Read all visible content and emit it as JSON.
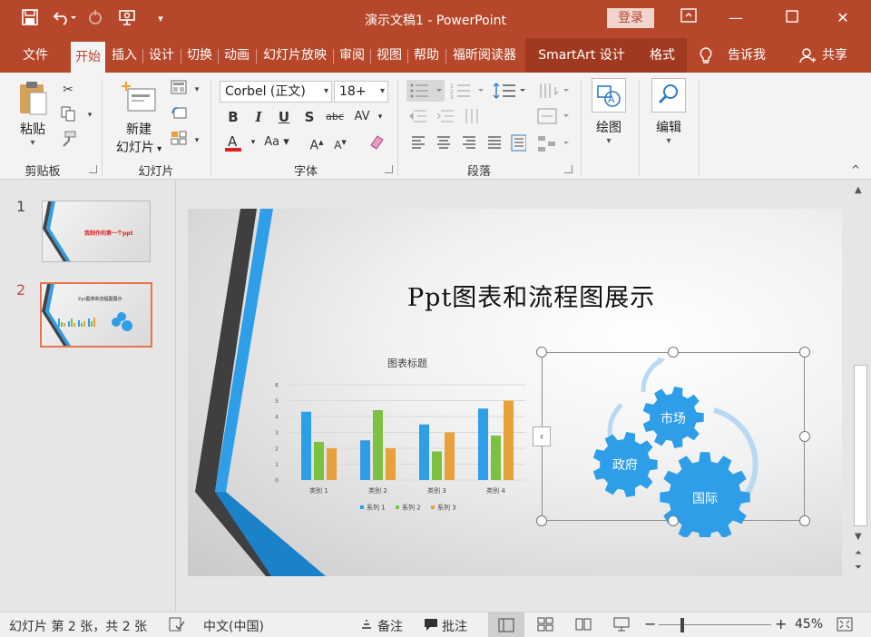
{
  "titlebar": {
    "doc_title": "演示文稿1  -  PowerPoint",
    "login_label": "登录"
  },
  "tabs": [
    {
      "label": "文件"
    },
    {
      "label": "开始"
    },
    {
      "label": "插入"
    },
    {
      "label": "设计"
    },
    {
      "label": "切换"
    },
    {
      "label": "动画"
    },
    {
      "label": "幻灯片放映"
    },
    {
      "label": "审阅"
    },
    {
      "label": "视图"
    },
    {
      "label": "帮助"
    },
    {
      "label": "福昕阅读器"
    },
    {
      "label": "SmartArt 设计"
    },
    {
      "label": "格式"
    },
    {
      "label": "告诉我"
    },
    {
      "label": "共享"
    }
  ],
  "ribbon": {
    "paste_label": "粘贴",
    "new_slide_label_1": "新建",
    "new_slide_label_2": "幻灯片",
    "font_name": "Corbel (正文)",
    "font_size": "18+",
    "draw_label": "绘图",
    "edit_label": "编辑",
    "groups": {
      "clipboard": "剪贴板",
      "slides": "幻灯片",
      "font": "字体",
      "paragraph": "段落"
    }
  },
  "thumbnails": [
    {
      "num": "1",
      "title": "我制作的第一个ppt"
    },
    {
      "num": "2",
      "title": "Ppt图表和流程图展示"
    }
  ],
  "slide": {
    "title": "Ppt图表和流程图展示",
    "smartart": {
      "gear_labels": [
        "市场",
        "政府",
        "国际"
      ]
    }
  },
  "chart_data": {
    "type": "bar",
    "title": "图表标题",
    "categories": [
      "类别 1",
      "类别 2",
      "类别 3",
      "类别 4"
    ],
    "series": [
      {
        "name": "系列 1",
        "values": [
          4.3,
          2.5,
          3.5,
          4.5
        ],
        "color": "#2e9ee8"
      },
      {
        "name": "系列 2",
        "values": [
          2.4,
          4.4,
          1.8,
          2.8
        ],
        "color": "#7cc242"
      },
      {
        "name": "系列 3",
        "values": [
          2.0,
          2.0,
          3.0,
          5.0
        ],
        "color": "#e8a03a"
      }
    ],
    "ylim": [
      0,
      6
    ],
    "yticks": [
      "0",
      "1",
      "2",
      "3",
      "4",
      "5",
      "6"
    ],
    "grid": true,
    "legend": "bottom"
  },
  "status": {
    "slide_info": "幻灯片 第 2 张，共 2 张",
    "language": "中文(中国)",
    "notes_label": "备注",
    "comments_label": "批注",
    "zoom": "45%"
  },
  "colors": {
    "accent": "#b7472a",
    "chart_blue": "#2e9ee8",
    "gear_blue": "#2e9ee8"
  }
}
